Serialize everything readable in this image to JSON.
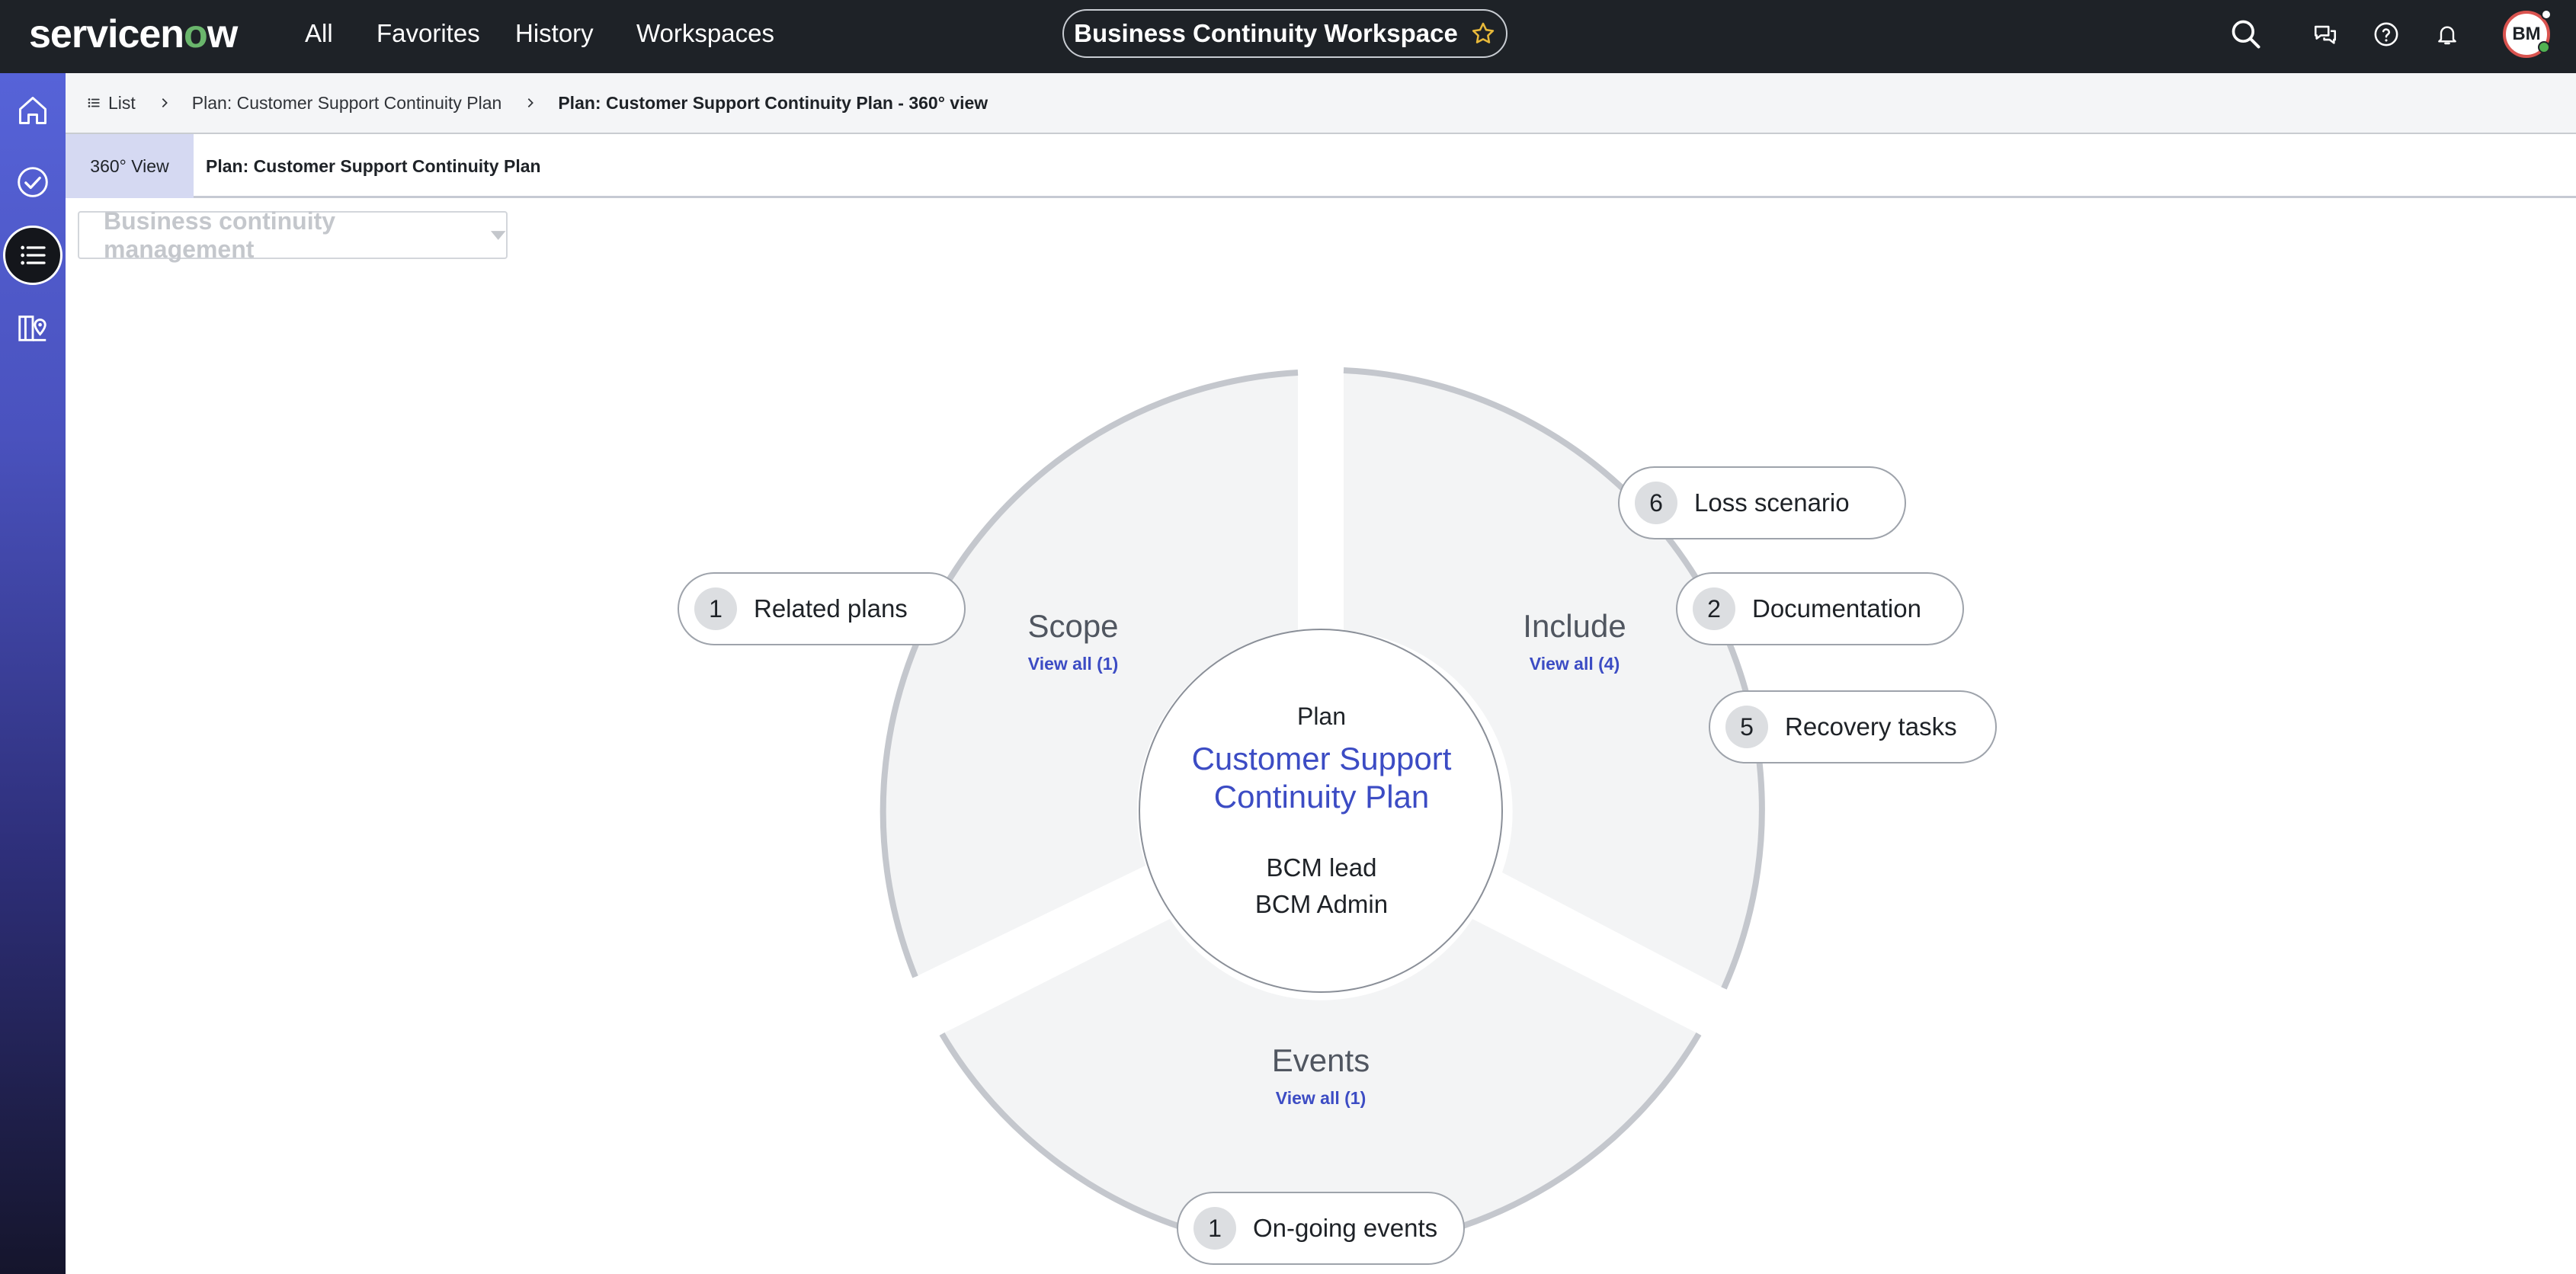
{
  "header": {
    "logo_pre": "servicen",
    "logo_o": "o",
    "logo_post": "w",
    "nav": [
      "All",
      "Favorites",
      "History",
      "Workspaces"
    ],
    "workspace_title": "Business Continuity Workspace",
    "avatar_initials": "BM"
  },
  "breadcrumbs": {
    "list": "List",
    "plan": "Plan: Customer Support Continuity Plan",
    "current": "Plan: Customer Support Continuity Plan - 360° view"
  },
  "tabs": {
    "view360": "360° View",
    "plan": "Plan: Customer Support Continuity Plan"
  },
  "dropdown": {
    "value": "Business continuity management"
  },
  "diagram": {
    "center": {
      "type": "Plan",
      "name_line1": "Customer Support",
      "name_line2": "Continuity Plan",
      "role": "BCM lead",
      "person": "BCM Admin"
    },
    "segments": {
      "scope": {
        "title": "Scope",
        "link": "View all (1)"
      },
      "include": {
        "title": "Include",
        "link": "View all (4)"
      },
      "events": {
        "title": "Events",
        "link": "View all (1)"
      }
    },
    "pills": {
      "related_plans": {
        "count": "1",
        "label": "Related plans"
      },
      "loss_scenario": {
        "count": "6",
        "label": "Loss scenario"
      },
      "documentation": {
        "count": "2",
        "label": "Documentation"
      },
      "recovery_tasks": {
        "count": "5",
        "label": "Recovery tasks"
      },
      "ongoing_events": {
        "count": "1",
        "label": "On-going events"
      }
    }
  },
  "colors": {
    "header_bg": "#1e2227",
    "accent": "#3c4cc4",
    "rail_top": "#5663d8",
    "rail_bottom": "#15152c"
  }
}
